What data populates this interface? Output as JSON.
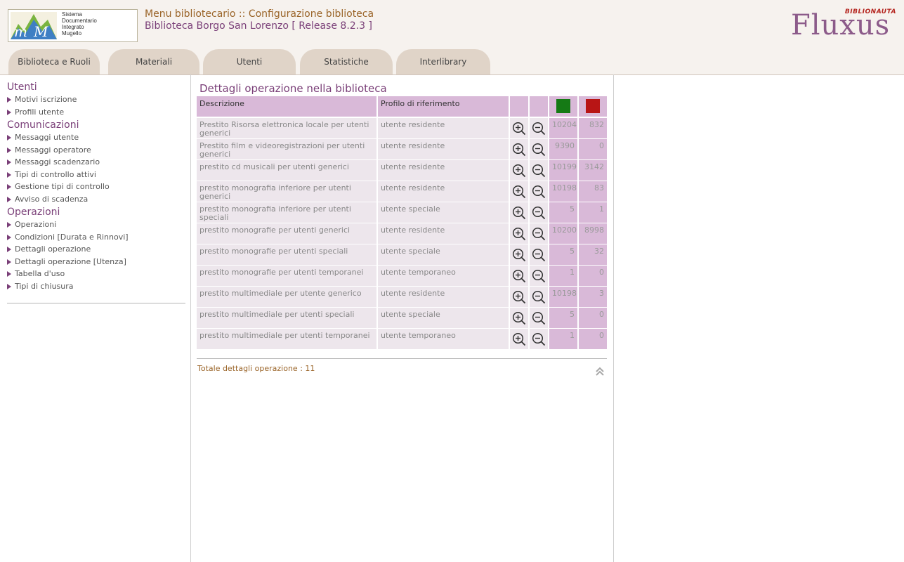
{
  "header": {
    "logo_lines": [
      "Sistema",
      "Documentario",
      "Integrato",
      "Mugello"
    ],
    "title_line1": "Menu bibliotecario :: Configurazione biblioteca",
    "title_line2": "Biblioteca Borgo San Lorenzo [ Release 8.2.3 ]",
    "brand_tag": "BIBLIONAUTA",
    "brand_name": "Fluxus"
  },
  "tabs": [
    {
      "label": "Biblioteca e Ruoli"
    },
    {
      "label": "Materiali"
    },
    {
      "label": "Utenti"
    },
    {
      "label": "Statistiche"
    },
    {
      "label": "Interlibrary"
    }
  ],
  "sidebar": {
    "sections": [
      {
        "title": "Utenti",
        "items": [
          "Motivi iscrizione",
          "Profili utente"
        ]
      },
      {
        "title": "Comunicazioni",
        "items": [
          "Messaggi utente",
          "Messaggi operatore",
          "Messaggi scadenzario",
          "Tipi di controllo attivi",
          "Gestione tipi di controllo",
          "Avviso di scadenza"
        ]
      },
      {
        "title": "Operazioni",
        "items": [
          "Operazioni",
          "Condizioni [Durata e Rinnovi]",
          "Dettagli operazione",
          "Dettagli operazione [Utenza]",
          "Tabella d'uso",
          "Tipi di chiusura"
        ]
      }
    ]
  },
  "main": {
    "title": "Dettagli operazione nella biblioteca",
    "table": {
      "headers": {
        "descrizione": "Descrizione",
        "profilo": "Profilo di riferimento"
      },
      "green_color": "#157a15",
      "red_color": "#b81515",
      "rows": [
        {
          "descrizione": "Prestito Risorsa elettronica locale per utenti generici",
          "profilo": "utente residente",
          "green": "10204",
          "red": "832"
        },
        {
          "descrizione": "Prestito film e videoregistrazioni per utenti generici",
          "profilo": "utente residente",
          "green": "9390",
          "red": "0"
        },
        {
          "descrizione": "prestito cd musicali per utenti generici",
          "profilo": "utente residente",
          "green": "10199",
          "red": "3142"
        },
        {
          "descrizione": "prestito monografia inferiore per utenti generici",
          "profilo": "utente residente",
          "green": "10198",
          "red": "83"
        },
        {
          "descrizione": "prestito monografia inferiore per utenti speciali",
          "profilo": "utente speciale",
          "green": "5",
          "red": "1"
        },
        {
          "descrizione": "prestito monografie per utenti generici",
          "profilo": "utente residente",
          "green": "10200",
          "red": "8998"
        },
        {
          "descrizione": "prestito monografie per utenti speciali",
          "profilo": "utente speciale",
          "green": "5",
          "red": "32"
        },
        {
          "descrizione": "prestito monografie per utenti temporanei",
          "profilo": "utente temporaneo",
          "green": "1",
          "red": "0"
        },
        {
          "descrizione": "prestito multimediale per utente generico",
          "profilo": "utente residente",
          "green": "10198",
          "red": "3"
        },
        {
          "descrizione": "prestito multimediale per utenti speciali",
          "profilo": "utente speciale",
          "green": "5",
          "red": "0"
        },
        {
          "descrizione": "prestito multimediale per utenti temporanei",
          "profilo": "utente temporaneo",
          "green": "1",
          "red": "0"
        }
      ]
    },
    "total": "Totale dettagli operazione : 11"
  }
}
